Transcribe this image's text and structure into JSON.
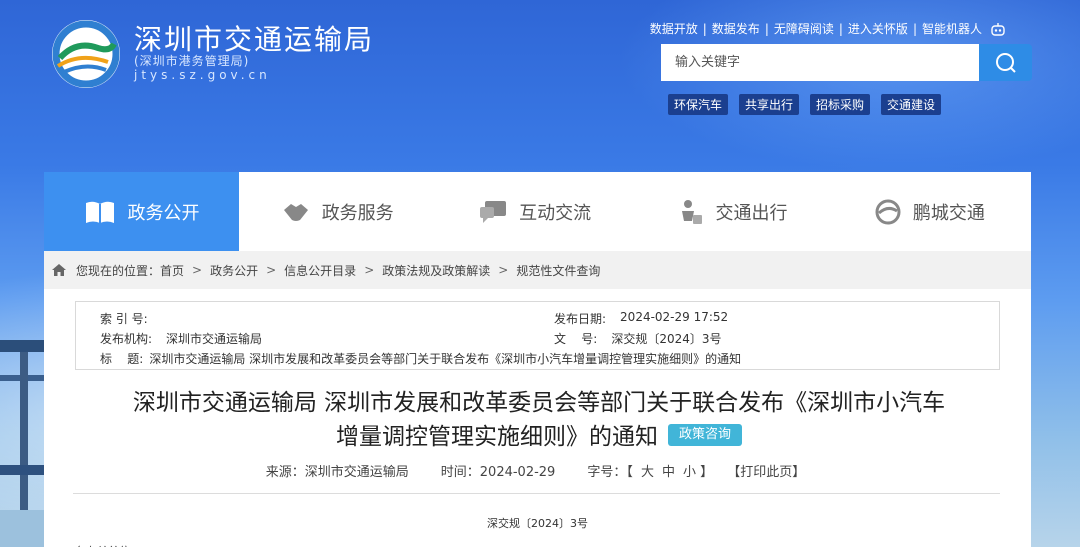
{
  "header": {
    "title": "深圳市交通运输局",
    "subtitle": "(深圳市港务管理局)",
    "domain": "jtys.sz.gov.cn",
    "top_links": [
      "数据开放",
      "数据发布",
      "无障碍阅读",
      "进入关怀版",
      "智能机器人"
    ],
    "robot_icon": "robot-icon",
    "search": {
      "placeholder": "输入关键字"
    },
    "tags": [
      "环保汽车",
      "共享出行",
      "招标采购",
      "交通建设"
    ]
  },
  "nav": {
    "items": [
      {
        "label": "政务公开",
        "icon": "book-icon",
        "active": true
      },
      {
        "label": "政务服务",
        "icon": "handshake-icon",
        "active": false
      },
      {
        "label": "互动交流",
        "icon": "chat-icon",
        "active": false
      },
      {
        "label": "交通出行",
        "icon": "traveler-icon",
        "active": false
      },
      {
        "label": "鹏城交通",
        "icon": "swirl-logo-icon",
        "active": false
      }
    ],
    "active_color": "#3d90f0"
  },
  "breadcrumb": {
    "prefix": "您现在的位置：",
    "items": [
      "首页",
      "政务公开",
      "信息公开目录",
      "政策法规及政策解读",
      "规范性文件查询"
    ]
  },
  "meta": {
    "index_label": "索 引 号:",
    "index_value": "",
    "org_label": "发布机构:",
    "org_value": "深圳市交通运输局",
    "title_label": "标    题:",
    "title_value": "深圳市交通运输局 深圳市发展和改革委员会等部门关于联合发布《深圳市小汽车增量调控管理实施细则》的通知",
    "date_label": "发布日期:",
    "date_value": "2024-02-29 17:52",
    "docno_label": "文    号:",
    "docno_value": "深交规〔2024〕3号"
  },
  "article": {
    "title_line1": "深圳市交通运输局 深圳市发展和改革委员会等部门关于联合发布《深圳市小汽车",
    "title_line2": "增量调控管理实施细则》的通知",
    "consult_badge": "政策咨询",
    "source": "来源：深圳市交通运输局",
    "time": "时间：2024-02-29",
    "font_label": "字号：",
    "font_open": "【",
    "font_large": "大",
    "font_medium": "中",
    "font_small": "小",
    "font_close": "】",
    "print": "【打印此页】",
    "doc_number": "深交规〔2024〕3号",
    "partial_text": "各有关单位："
  }
}
